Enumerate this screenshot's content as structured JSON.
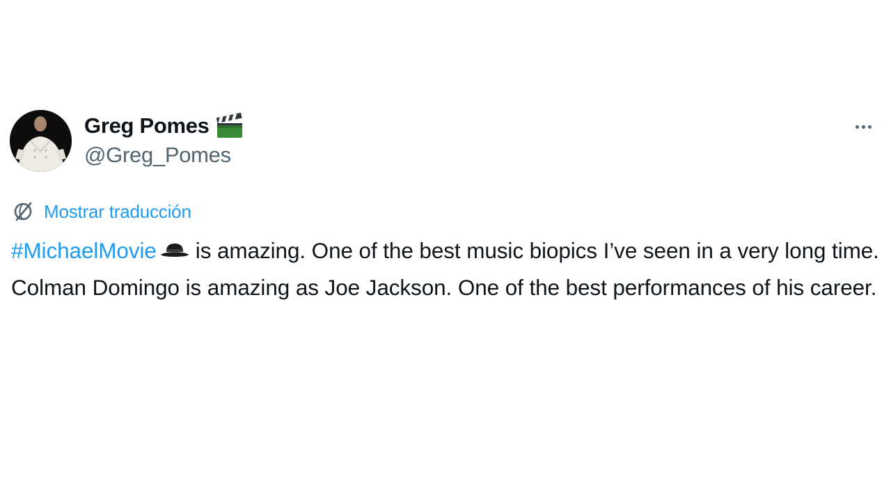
{
  "author": {
    "display_name": "Greg Pomes",
    "name_emoji": "clapper-board-icon",
    "handle": "@Greg_Pomes",
    "avatar": "user-avatar"
  },
  "menu": {
    "more_icon": "more-options-icon"
  },
  "translation": {
    "icon": "globe-icon",
    "label": "Mostrar traducción"
  },
  "tweet": {
    "hashtag": "#MichaelMovie",
    "hashtag_emoji": "fedora-hat-icon",
    "body": "is amazing. One of the best music biopics I’ve seen in a very long time. Colman Domingo is amazing as Joe Jackson. One of the best performances of his career."
  },
  "colors": {
    "link": "#1d9bf0",
    "text": "#0f1419",
    "secondary": "#536471"
  }
}
